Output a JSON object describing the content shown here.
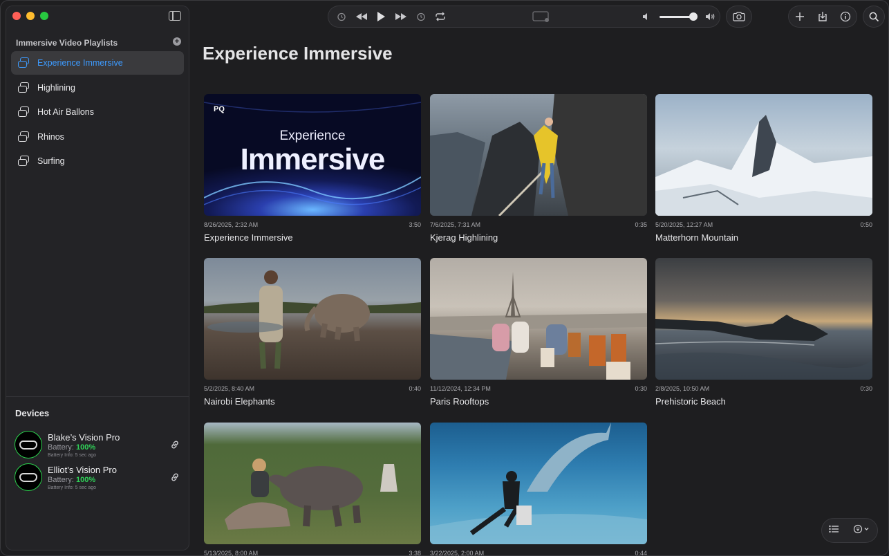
{
  "sidebar": {
    "playlists_header": "Immersive Video Playlists",
    "items": [
      {
        "label": "Experience Immersive"
      },
      {
        "label": "Highlining"
      },
      {
        "label": "Hot Air Ballons"
      },
      {
        "label": "Rhinos"
      },
      {
        "label": "Surfing"
      }
    ],
    "devices_header": "Devices",
    "devices": [
      {
        "name": "Blake’s Vision Pro",
        "battery_label": "Battery: ",
        "battery": "100%",
        "info": "Battery Info: 5 sec ago"
      },
      {
        "name": "Elliot’s Vision Pro",
        "battery_label": "Battery: ",
        "battery": "100%",
        "info": "Battery Info: 5 sec ago"
      }
    ]
  },
  "main": {
    "title": "Experience Immersive",
    "videos": [
      {
        "date": "8/26/2025, 2:32 AM",
        "duration": "3:50",
        "title": "Experience Immersive",
        "badge": "PQ",
        "poster_top": "Experience",
        "poster_main": "Immersive"
      },
      {
        "date": "7/6/2025, 7:31 AM",
        "duration": "0:35",
        "title": "Kjerag Highlining"
      },
      {
        "date": "5/20/2025, 12:27 AM",
        "duration": "0:50",
        "title": "Matterhorn Mountain"
      },
      {
        "date": "5/2/2025, 8:40 AM",
        "duration": "0:40",
        "title": "Nairobi Elephants"
      },
      {
        "date": "11/12/2024, 12:34 PM",
        "duration": "0:30",
        "title": "Paris Rooftops"
      },
      {
        "date": "2/8/2025, 10:50 AM",
        "duration": "0:30",
        "title": "Prehistoric Beach"
      },
      {
        "date": "5/13/2025, 8:00 AM",
        "duration": "3:38",
        "title": ""
      },
      {
        "date": "3/22/2025, 2:00 AM",
        "duration": "0:44",
        "title": ""
      }
    ]
  },
  "colors": {
    "accent": "#3d9bff",
    "battery": "#30d158"
  }
}
